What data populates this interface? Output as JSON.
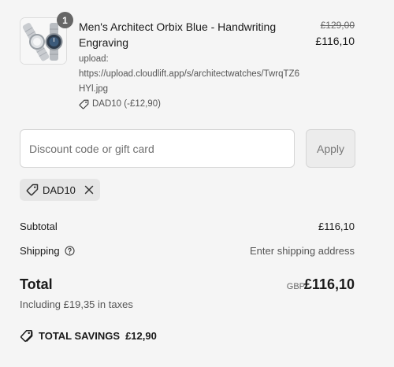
{
  "product": {
    "quantity": "1",
    "image_icon": "watch-product-image",
    "title": "Men's Architect Orbix Blue - Handwriting Engraving",
    "upload_label": "upload:",
    "upload_url": "https://upload.cloudlift.app/s/architectwatches/TwrqTZ6HYl.jpg",
    "discount_note": "DAD10 (-£12,90)",
    "original_price": "£129,00",
    "price": "£116,10"
  },
  "discount_form": {
    "placeholder": "Discount code or gift card",
    "value": "",
    "apply_label": "Apply"
  },
  "applied_code": {
    "code": "DAD10",
    "tag_icon": "tag-icon",
    "remove_icon": "close-icon"
  },
  "summary": {
    "subtotal_label": "Subtotal",
    "subtotal_value": "£116,10",
    "shipping_label": "Shipping",
    "shipping_info_icon": "help-circle-icon",
    "shipping_value": "Enter shipping address",
    "total_label": "Total",
    "currency": "GBP",
    "total_value": "£116,10",
    "tax_note": "Including £19,35 in taxes",
    "savings_label": "TOTAL SAVINGS",
    "savings_value": "£12,90"
  }
}
